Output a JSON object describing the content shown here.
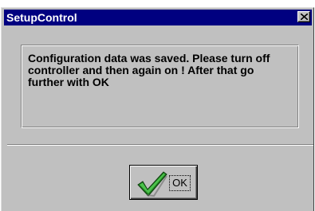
{
  "window": {
    "title": "SetupControl",
    "close_icon": "close-icon"
  },
  "message": "Configuration data was saved. Please turn off controller and then again on ! After that go further with OK",
  "ok_button": {
    "label": "OK",
    "icon": "green-checkmark-icon",
    "icon_color": "#2a9a2a"
  },
  "colors": {
    "titlebar": "#000080",
    "dialog_face": "#c0c0c0"
  }
}
